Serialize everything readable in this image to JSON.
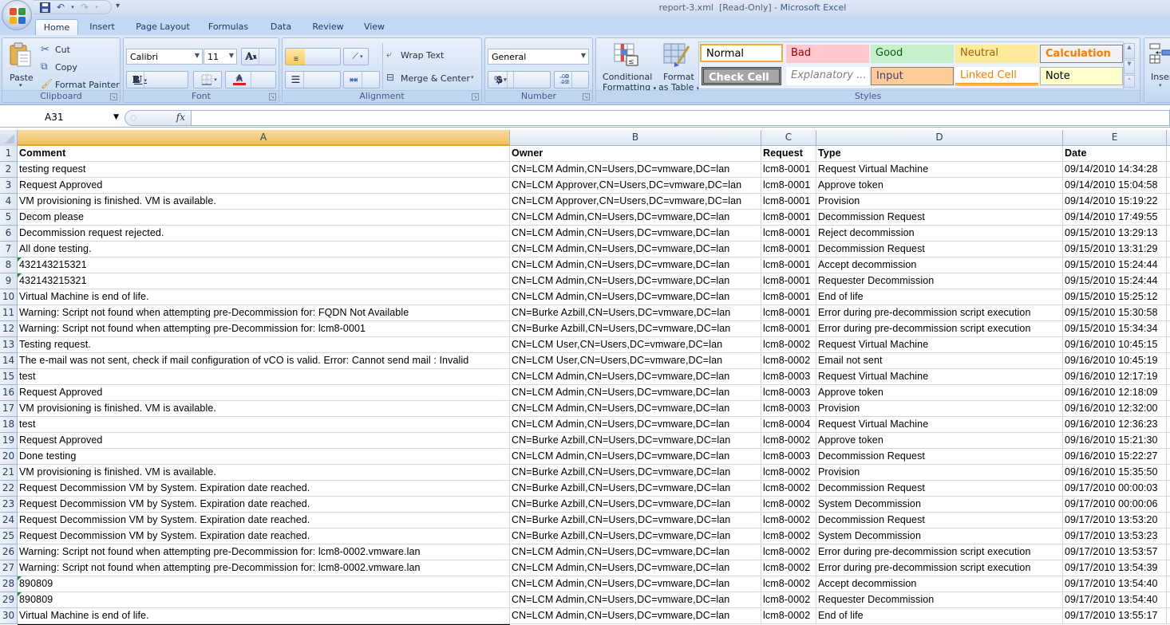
{
  "window": {
    "file": "report-3.xml",
    "status": "[Read-Only]",
    "separator": "-",
    "app": "Microsoft Excel"
  },
  "quick_access": {
    "save": "save-icon",
    "undo": "undo-icon",
    "redo": "redo-icon",
    "customize": "▾"
  },
  "tabs": [
    {
      "label": "Home",
      "active": true
    },
    {
      "label": "Insert"
    },
    {
      "label": "Page Layout"
    },
    {
      "label": "Formulas"
    },
    {
      "label": "Data"
    },
    {
      "label": "Review"
    },
    {
      "label": "View"
    }
  ],
  "ribbon": {
    "clipboard": {
      "label": "Clipboard",
      "paste": "Paste",
      "cut": "Cut",
      "copy": "Copy",
      "format_painter": "Format Painter"
    },
    "font": {
      "label": "Font",
      "font_name": "Calibri",
      "font_size": "11",
      "grow": "A",
      "shrink": "A",
      "bold": "B",
      "italic": "I",
      "underline": "U",
      "highlight_color": "#ffff00",
      "font_color": "#e31b1b"
    },
    "alignment": {
      "label": "Alignment",
      "wrap_text": "Wrap Text",
      "merge_center": "Merge & Center"
    },
    "number": {
      "label": "Number",
      "format": "General",
      "currency": "$",
      "percent": "%",
      "comma": ",",
      "inc_decimal": "←.0 .00",
      "dec_decimal": ".00 →.0"
    },
    "styles": {
      "label": "Styles",
      "conditional_formatting_1": "Conditional",
      "conditional_formatting_2": "Formatting",
      "format_table_1": "Format",
      "format_table_2": "as Table",
      "chips": [
        {
          "label": "Normal",
          "bg": "#ffffff",
          "fg": "#000000"
        },
        {
          "label": "Bad",
          "bg": "#ffc7ce",
          "fg": "#9c0006"
        },
        {
          "label": "Good",
          "bg": "#c6efce",
          "fg": "#006100"
        },
        {
          "label": "Neutral",
          "bg": "#ffeb9c",
          "fg": "#9c6500"
        },
        {
          "label": "Calculation",
          "bg": "#f2f2f2",
          "fg": "#fa7d00"
        },
        {
          "label": "Check Cell",
          "bg": "#a5a5a5",
          "fg": "#ffffff"
        },
        {
          "label": "Explanatory ...",
          "bg": "#ffffff",
          "fg": "#7f7f7f"
        },
        {
          "label": "Input",
          "bg": "#ffcc99",
          "fg": "#3f3f76"
        },
        {
          "label": "Linked Cell",
          "bg": "#ffffff",
          "fg": "#fa7d00"
        },
        {
          "label": "Note",
          "bg": "#ffffcc",
          "fg": "#000000"
        }
      ]
    },
    "cells": {
      "insert": "Inser"
    }
  },
  "formula_bar": {
    "name_box": "A31",
    "fx": "fx",
    "value": ""
  },
  "sheet": {
    "columns": [
      "A",
      "B",
      "C",
      "D",
      "E"
    ],
    "selected_column": "A",
    "rows": [
      {
        "n": "1",
        "cells": [
          "Comment",
          "Owner",
          "Request",
          "Type",
          "Date"
        ]
      },
      {
        "n": "2",
        "cells": [
          "testing request",
          "CN=LCM Admin,CN=Users,DC=vmware,DC=lan",
          "lcm8-0001",
          "Request Virtual Machine",
          "09/14/2010 14:34:28"
        ]
      },
      {
        "n": "3",
        "cells": [
          "Request Approved",
          "CN=LCM Approver,CN=Users,DC=vmware,DC=lan",
          "lcm8-0001",
          "Approve token",
          "09/14/2010 15:04:58"
        ]
      },
      {
        "n": "4",
        "cells": [
          "VM provisioning is finished. VM is available.",
          "CN=LCM Approver,CN=Users,DC=vmware,DC=lan",
          "lcm8-0001",
          "Provision",
          "09/14/2010 15:19:22"
        ]
      },
      {
        "n": "5",
        "cells": [
          "Decom please",
          "CN=LCM Admin,CN=Users,DC=vmware,DC=lan",
          "lcm8-0001",
          "Decommission Request",
          "09/14/2010 17:49:55"
        ]
      },
      {
        "n": "6",
        "cells": [
          "Decommission request rejected.",
          "CN=LCM Admin,CN=Users,DC=vmware,DC=lan",
          "lcm8-0001",
          "Reject decommission",
          "09/15/2010 13:29:13"
        ]
      },
      {
        "n": "7",
        "cells": [
          "All done testing.",
          "CN=LCM Admin,CN=Users,DC=vmware,DC=lan",
          "lcm8-0001",
          "Decommission Request",
          "09/15/2010 13:31:29"
        ]
      },
      {
        "n": "8",
        "cells": [
          "432143215321",
          "CN=LCM Admin,CN=Users,DC=vmware,DC=lan",
          "lcm8-0001",
          "Accept decommission",
          "09/15/2010 15:24:44"
        ],
        "num_as_text": true
      },
      {
        "n": "9",
        "cells": [
          "432143215321",
          "CN=LCM Admin,CN=Users,DC=vmware,DC=lan",
          "lcm8-0001",
          "Requester Decommission",
          "09/15/2010 15:24:44"
        ],
        "num_as_text": true
      },
      {
        "n": "10",
        "cells": [
          "Virtual Machine is end of life.",
          "CN=LCM Admin,CN=Users,DC=vmware,DC=lan",
          "lcm8-0001",
          "End of life",
          "09/15/2010 15:25:12"
        ]
      },
      {
        "n": "11",
        "cells": [
          "Warning: Script not found when attempting pre-Decommission for: FQDN Not Available",
          "CN=Burke Azbill,CN=Users,DC=vmware,DC=lan",
          "lcm8-0001",
          "Error during pre-decommission script execution",
          "09/15/2010 15:30:58"
        ]
      },
      {
        "n": "12",
        "cells": [
          "Warning: Script not found when attempting pre-Decommission for: lcm8-0001",
          "CN=Burke Azbill,CN=Users,DC=vmware,DC=lan",
          "lcm8-0001",
          "Error during pre-decommission script execution",
          "09/15/2010 15:34:34"
        ]
      },
      {
        "n": "13",
        "cells": [
          "Testing request.",
          "CN=LCM User,CN=Users,DC=vmware,DC=lan",
          "lcm8-0002",
          "Request Virtual Machine",
          "09/16/2010 10:45:15"
        ]
      },
      {
        "n": "14",
        "cells": [
          "The e-mail was not sent, check if mail configuration of vCO is valid. Error: Cannot send mail : Invalid",
          "CN=LCM User,CN=Users,DC=vmware,DC=lan",
          "lcm8-0002",
          "Email not sent",
          "09/16/2010 10:45:19"
        ]
      },
      {
        "n": "15",
        "cells": [
          "test",
          "CN=LCM Admin,CN=Users,DC=vmware,DC=lan",
          "lcm8-0003",
          "Request Virtual Machine",
          "09/16/2010 12:17:19"
        ]
      },
      {
        "n": "16",
        "cells": [
          "Request Approved",
          "CN=LCM Admin,CN=Users,DC=vmware,DC=lan",
          "lcm8-0003",
          "Approve token",
          "09/16/2010 12:18:09"
        ]
      },
      {
        "n": "17",
        "cells": [
          "VM provisioning is finished. VM is available.",
          "CN=LCM Admin,CN=Users,DC=vmware,DC=lan",
          "lcm8-0003",
          "Provision",
          "09/16/2010 12:32:00"
        ]
      },
      {
        "n": "18",
        "cells": [
          "test",
          "CN=LCM Admin,CN=Users,DC=vmware,DC=lan",
          "lcm8-0004",
          "Request Virtual Machine",
          "09/16/2010 12:36:23"
        ]
      },
      {
        "n": "19",
        "cells": [
          "Request Approved",
          "CN=Burke Azbill,CN=Users,DC=vmware,DC=lan",
          "lcm8-0002",
          "Approve token",
          "09/16/2010 15:21:30"
        ]
      },
      {
        "n": "20",
        "cells": [
          "Done testing",
          "CN=LCM Admin,CN=Users,DC=vmware,DC=lan",
          "lcm8-0003",
          "Decommission Request",
          "09/16/2010 15:22:27"
        ]
      },
      {
        "n": "21",
        "cells": [
          "VM provisioning is finished. VM is available.",
          "CN=Burke Azbill,CN=Users,DC=vmware,DC=lan",
          "lcm8-0002",
          "Provision",
          "09/16/2010 15:35:50"
        ]
      },
      {
        "n": "22",
        "cells": [
          "Request Decommission VM by System. Expiration date reached.",
          "CN=Burke Azbill,CN=Users,DC=vmware,DC=lan",
          "lcm8-0002",
          "Decommission Request",
          "09/17/2010 00:00:03"
        ]
      },
      {
        "n": "23",
        "cells": [
          "Request Decommission VM by System. Expiration date reached.",
          "CN=Burke Azbill,CN=Users,DC=vmware,DC=lan",
          "lcm8-0002",
          "System Decommission",
          "09/17/2010 00:00:06"
        ]
      },
      {
        "n": "24",
        "cells": [
          "Request Decommission VM by System. Expiration date reached.",
          "CN=Burke Azbill,CN=Users,DC=vmware,DC=lan",
          "lcm8-0002",
          "Decommission Request",
          "09/17/2010 13:53:20"
        ]
      },
      {
        "n": "25",
        "cells": [
          "Request Decommission VM by System. Expiration date reached.",
          "CN=Burke Azbill,CN=Users,DC=vmware,DC=lan",
          "lcm8-0002",
          "System Decommission",
          "09/17/2010 13:53:23"
        ]
      },
      {
        "n": "26",
        "cells": [
          "Warning: Script not found when attempting pre-Decommission for: lcm8-0002.vmware.lan",
          "CN=LCM Admin,CN=Users,DC=vmware,DC=lan",
          "lcm8-0002",
          "Error during pre-decommission script execution",
          "09/17/2010 13:53:57"
        ]
      },
      {
        "n": "27",
        "cells": [
          "Warning: Script not found when attempting pre-Decommission for: lcm8-0002.vmware.lan",
          "CN=LCM Admin,CN=Users,DC=vmware,DC=lan",
          "lcm8-0002",
          "Error during pre-decommission script execution",
          "09/17/2010 13:54:39"
        ]
      },
      {
        "n": "28",
        "cells": [
          "890809",
          "CN=LCM Admin,CN=Users,DC=vmware,DC=lan",
          "lcm8-0002",
          "Accept decommission",
          "09/17/2010 13:54:40"
        ],
        "num_as_text": true
      },
      {
        "n": "29",
        "cells": [
          "890809",
          "CN=LCM Admin,CN=Users,DC=vmware,DC=lan",
          "lcm8-0002",
          "Requester Decommission",
          "09/17/2010 13:54:40"
        ],
        "num_as_text": true
      },
      {
        "n": "30",
        "cells": [
          "Virtual Machine is end of life.",
          "CN=LCM Admin,CN=Users,DC=vmware,DC=lan",
          "lcm8-0002",
          "End of life",
          "09/17/2010 13:55:17"
        ]
      }
    ]
  }
}
